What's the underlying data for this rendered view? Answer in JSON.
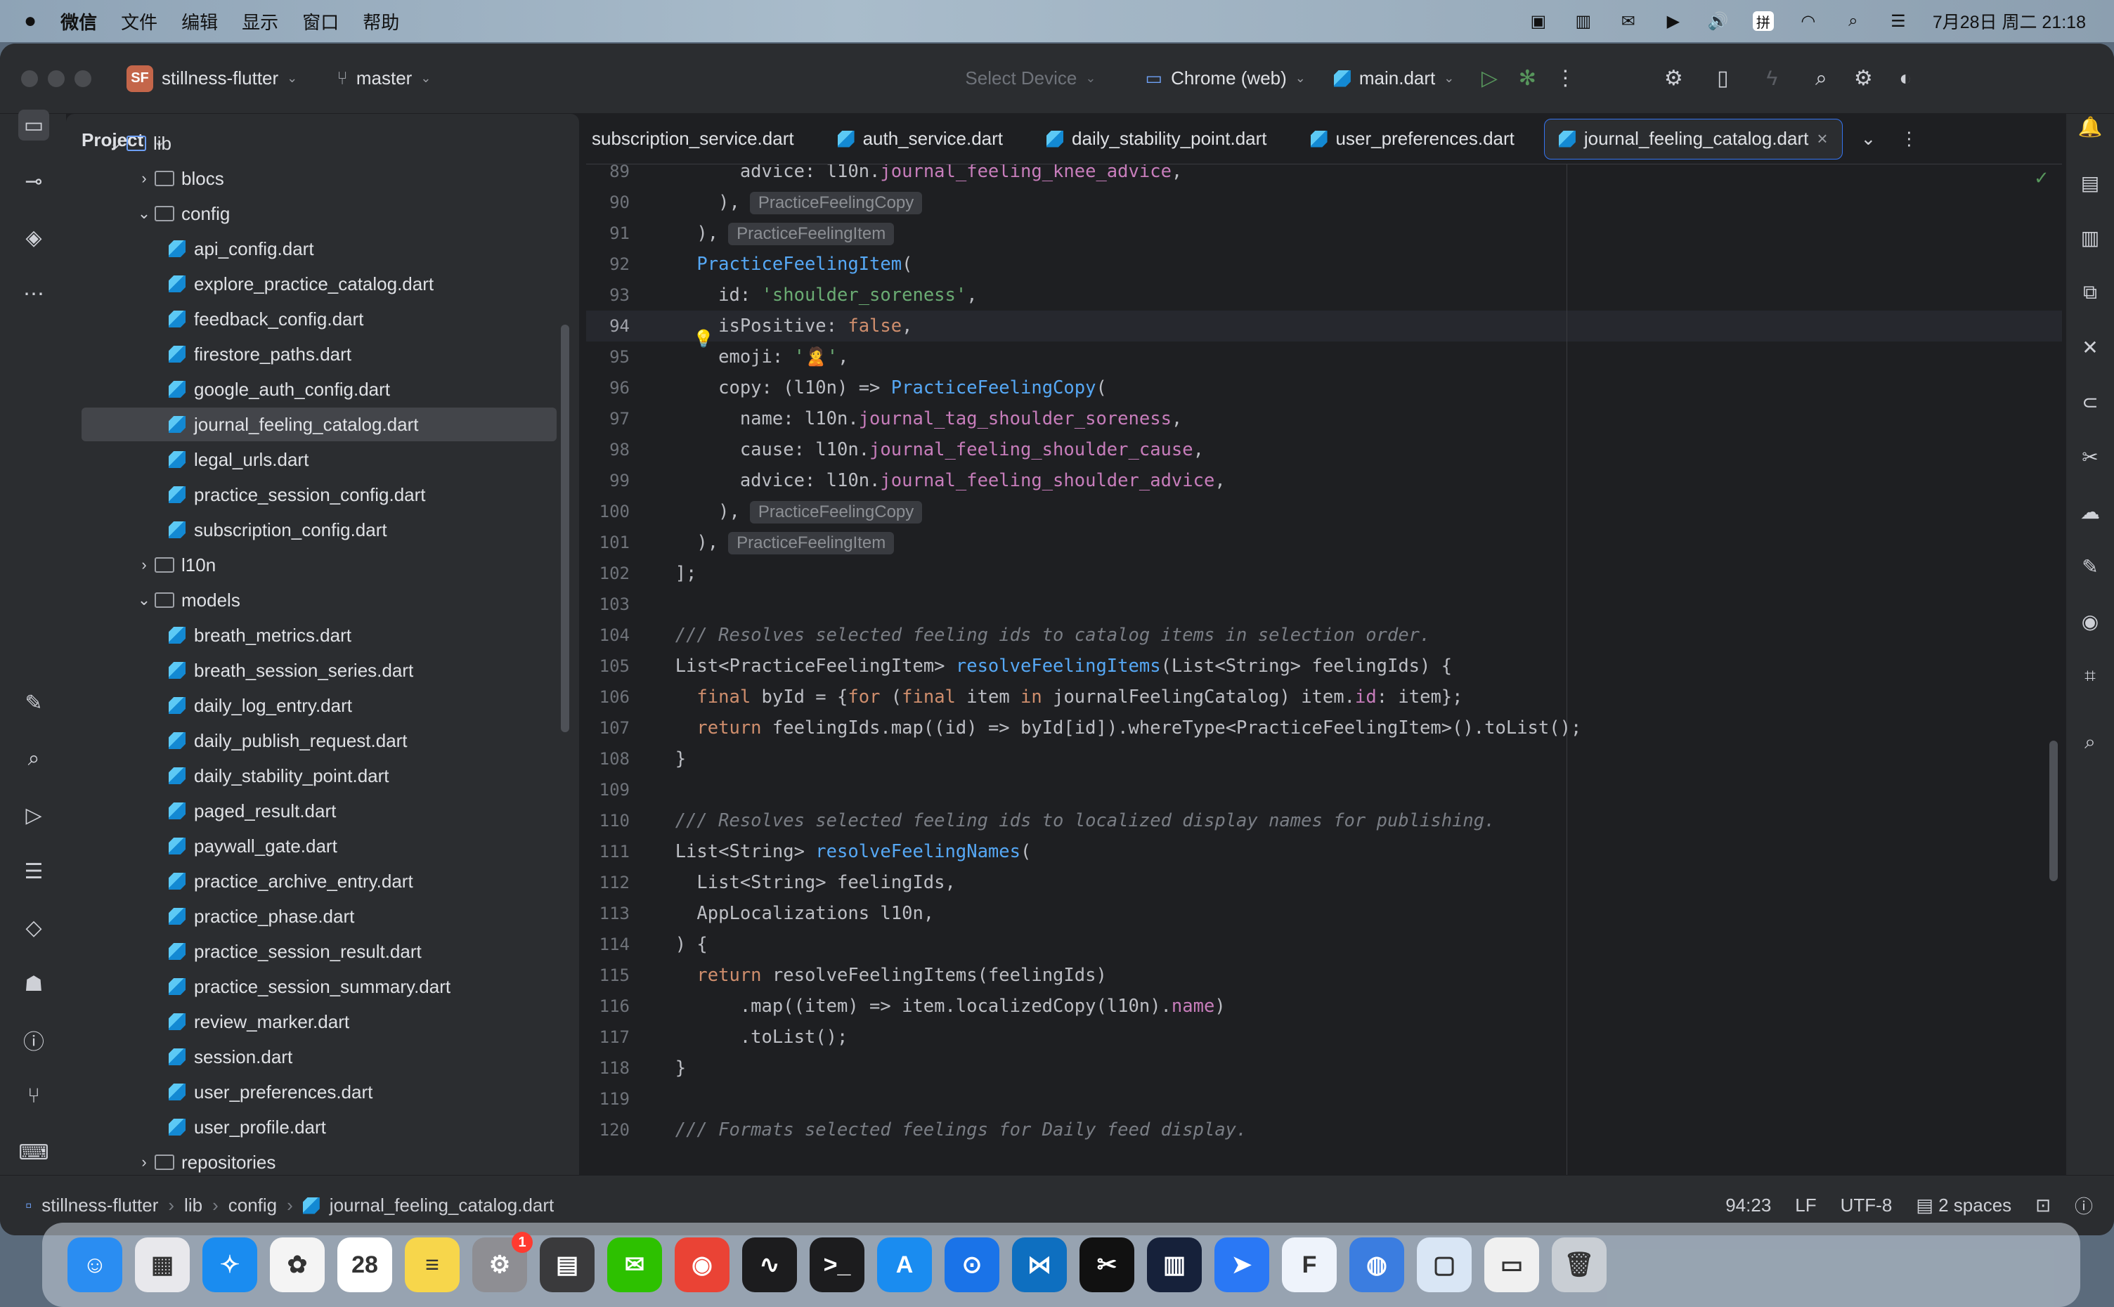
{
  "menubar": {
    "apple": "",
    "items": [
      "微信",
      "文件",
      "编辑",
      "显示",
      "窗口",
      "帮助"
    ],
    "clock": "7月28日 周二 21:18",
    "input_method": "拼"
  },
  "titlebar": {
    "project_badge": "SF",
    "project_name": "stillness-flutter",
    "branch": "master",
    "device_placeholder": "Select Device",
    "device": "Chrome (web)",
    "run_config": "main.dart"
  },
  "project_panel": {
    "title": "Project",
    "rows": [
      {
        "label": "lib",
        "kind": "folder-open"
      },
      {
        "label": "blocs",
        "kind": "folder"
      },
      {
        "label": "config",
        "kind": "folder-open"
      },
      {
        "label": "api_config.dart",
        "kind": "file"
      },
      {
        "label": "explore_practice_catalog.dart",
        "kind": "file"
      },
      {
        "label": "feedback_config.dart",
        "kind": "file"
      },
      {
        "label": "firestore_paths.dart",
        "kind": "file"
      },
      {
        "label": "google_auth_config.dart",
        "kind": "file"
      },
      {
        "label": "journal_feeling_catalog.dart",
        "kind": "file",
        "selected": true
      },
      {
        "label": "legal_urls.dart",
        "kind": "file"
      },
      {
        "label": "practice_session_config.dart",
        "kind": "file"
      },
      {
        "label": "subscription_config.dart",
        "kind": "file"
      },
      {
        "label": "l10n",
        "kind": "folder"
      },
      {
        "label": "models",
        "kind": "folder-open"
      },
      {
        "label": "breath_metrics.dart",
        "kind": "file"
      },
      {
        "label": "breath_session_series.dart",
        "kind": "file"
      },
      {
        "label": "daily_log_entry.dart",
        "kind": "file"
      },
      {
        "label": "daily_publish_request.dart",
        "kind": "file"
      },
      {
        "label": "daily_stability_point.dart",
        "kind": "file"
      },
      {
        "label": "paged_result.dart",
        "kind": "file"
      },
      {
        "label": "paywall_gate.dart",
        "kind": "file"
      },
      {
        "label": "practice_archive_entry.dart",
        "kind": "file"
      },
      {
        "label": "practice_phase.dart",
        "kind": "file"
      },
      {
        "label": "practice_session_result.dart",
        "kind": "file"
      },
      {
        "label": "practice_session_summary.dart",
        "kind": "file"
      },
      {
        "label": "review_marker.dart",
        "kind": "file"
      },
      {
        "label": "session.dart",
        "kind": "file"
      },
      {
        "label": "user_preferences.dart",
        "kind": "file"
      },
      {
        "label": "user_profile.dart",
        "kind": "file"
      },
      {
        "label": "repositories",
        "kind": "folder"
      }
    ]
  },
  "tabs": [
    {
      "label": "subscription_service.dart"
    },
    {
      "label": "auth_service.dart"
    },
    {
      "label": "daily_stability_point.dart"
    },
    {
      "label": "user_preferences.dart"
    },
    {
      "label": "journal_feeling_catalog.dart",
      "active": true
    }
  ],
  "code": {
    "current_line": "94",
    "lines": [
      {
        "n": "89",
        "html": "        advice: l10n.<span class='field'>journal_feeling_knee_advice</span>,"
      },
      {
        "n": "90",
        "html": "      ),",
        "hint": "PracticeFeelingCopy"
      },
      {
        "n": "91",
        "html": "    ),",
        "hint": "PracticeFeelingItem"
      },
      {
        "n": "92",
        "html": "    <span class='cls'>PracticeFeelingItem</span>("
      },
      {
        "n": "93",
        "html": "      id: <span class='str'>'shoulder_soreness'</span>,"
      },
      {
        "n": "94",
        "html": "      isPositive: <span class='kw'>false</span>,"
      },
      {
        "n": "95",
        "html": "      emoji: <span class='str'>'🙎'</span>,"
      },
      {
        "n": "96",
        "html": "      copy: (l10n) => <span class='cls'>PracticeFeelingCopy</span>("
      },
      {
        "n": "97",
        "html": "        name: l10n.<span class='field'>journal_tag_shoulder_soreness</span>,"
      },
      {
        "n": "98",
        "html": "        cause: l10n.<span class='field'>journal_feeling_shoulder_cause</span>,"
      },
      {
        "n": "99",
        "html": "        advice: l10n.<span class='field'>journal_feeling_shoulder_advice</span>,"
      },
      {
        "n": "100",
        "html": "      ),",
        "hint": "PracticeFeelingCopy"
      },
      {
        "n": "101",
        "html": "    ),",
        "hint": "PracticeFeelingItem"
      },
      {
        "n": "102",
        "html": "  ];"
      },
      {
        "n": "103",
        "html": ""
      },
      {
        "n": "104",
        "html": "  <span class='cmt'>/// Resolves selected feeling ids to catalog items in selection order.</span>"
      },
      {
        "n": "105",
        "html": "  List&lt;PracticeFeelingItem&gt; <span class='fn'>resolveFeelingItems</span>(List&lt;String&gt; feelingIds) {"
      },
      {
        "n": "106",
        "html": "    <span class='kw'>final</span> byId = {<span class='kw'>for</span> (<span class='kw'>final</span> item <span class='kw'>in</span> journalFeelingCatalog) item.<span class='field'>id</span>: item};"
      },
      {
        "n": "107",
        "html": "    <span class='kw'>return</span> feelingIds.map((id) => byId[id]).whereType&lt;PracticeFeelingItem&gt;().toList();"
      },
      {
        "n": "108",
        "html": "  }"
      },
      {
        "n": "109",
        "html": ""
      },
      {
        "n": "110",
        "html": "  <span class='cmt'>/// Resolves selected feeling ids to localized display names for publishing.</span>"
      },
      {
        "n": "111",
        "html": "  List&lt;String&gt; <span class='fn'>resolveFeelingNames</span>("
      },
      {
        "n": "112",
        "html": "    List&lt;String&gt; feelingIds,"
      },
      {
        "n": "113",
        "html": "    AppLocalizations l10n,"
      },
      {
        "n": "114",
        "html": "  ) {"
      },
      {
        "n": "115",
        "html": "    <span class='kw'>return</span> resolveFeelingItems(feelingIds)"
      },
      {
        "n": "116",
        "html": "        .map((item) => item.localizedCopy(l10n).<span class='field'>name</span>)"
      },
      {
        "n": "117",
        "html": "        .toList();"
      },
      {
        "n": "118",
        "html": "  }"
      },
      {
        "n": "119",
        "html": ""
      },
      {
        "n": "120",
        "html": "  <span class='cmt'>/// Formats selected feelings for Daily feed display.</span>"
      }
    ]
  },
  "statusbar": {
    "breadcrumb": [
      "stillness-flutter",
      "lib",
      "config",
      "journal_feeling_catalog.dart"
    ],
    "position": "94:23",
    "line_sep": "LF",
    "encoding": "UTF-8",
    "indent": "2 spaces"
  },
  "dock": {
    "apps": [
      {
        "name": "Finder",
        "color": "#2a8df2",
        "glyph": "☺"
      },
      {
        "name": "Launchpad",
        "color": "#e8e8ec",
        "glyph": "▦"
      },
      {
        "name": "Safari",
        "color": "#1a8cf0",
        "glyph": "✧"
      },
      {
        "name": "Photos",
        "color": "#f4f4f4",
        "glyph": "✿"
      },
      {
        "name": "Calendar",
        "color": "#ffffff",
        "glyph": "28"
      },
      {
        "name": "Notes",
        "color": "#f7d64b",
        "glyph": "≡"
      },
      {
        "name": "System Settings",
        "color": "#8e8e93",
        "glyph": "⚙",
        "badge": "1"
      },
      {
        "name": "Calculator",
        "color": "#3a3a3c",
        "glyph": "▤"
      },
      {
        "name": "WeChat",
        "color": "#2dc100",
        "glyph": "✉"
      },
      {
        "name": "Chrome",
        "color": "#ea4335",
        "glyph": "◉"
      },
      {
        "name": "Activity Monitor",
        "color": "#1c1c1e",
        "glyph": "∿"
      },
      {
        "name": "Terminal",
        "color": "#1c1c1e",
        "glyph": ">_"
      },
      {
        "name": "App Store",
        "color": "#1a8cf0",
        "glyph": "A"
      },
      {
        "name": "Maps Pin",
        "color": "#1a73e8",
        "glyph": "⊙"
      },
      {
        "name": "VS Code",
        "color": "#0e6fc0",
        "glyph": "⋈"
      },
      {
        "name": "CapCut",
        "color": "#111111",
        "glyph": "✂"
      },
      {
        "name": "Audio",
        "color": "#16213a",
        "glyph": "▥"
      },
      {
        "name": "Feishu",
        "color": "#2a78f5",
        "glyph": "➤"
      },
      {
        "name": "Flutter",
        "color": "#eef3fb",
        "glyph": "F"
      },
      {
        "name": "Database",
        "color": "#3b7de0",
        "glyph": "◍"
      },
      {
        "name": "Files",
        "color": "#d9e6f5",
        "glyph": "▢"
      },
      {
        "name": "Preview",
        "color": "#f0f0f0",
        "glyph": "▭"
      },
      {
        "name": "Trash",
        "color": "#c9ced4",
        "glyph": "🗑"
      }
    ]
  }
}
